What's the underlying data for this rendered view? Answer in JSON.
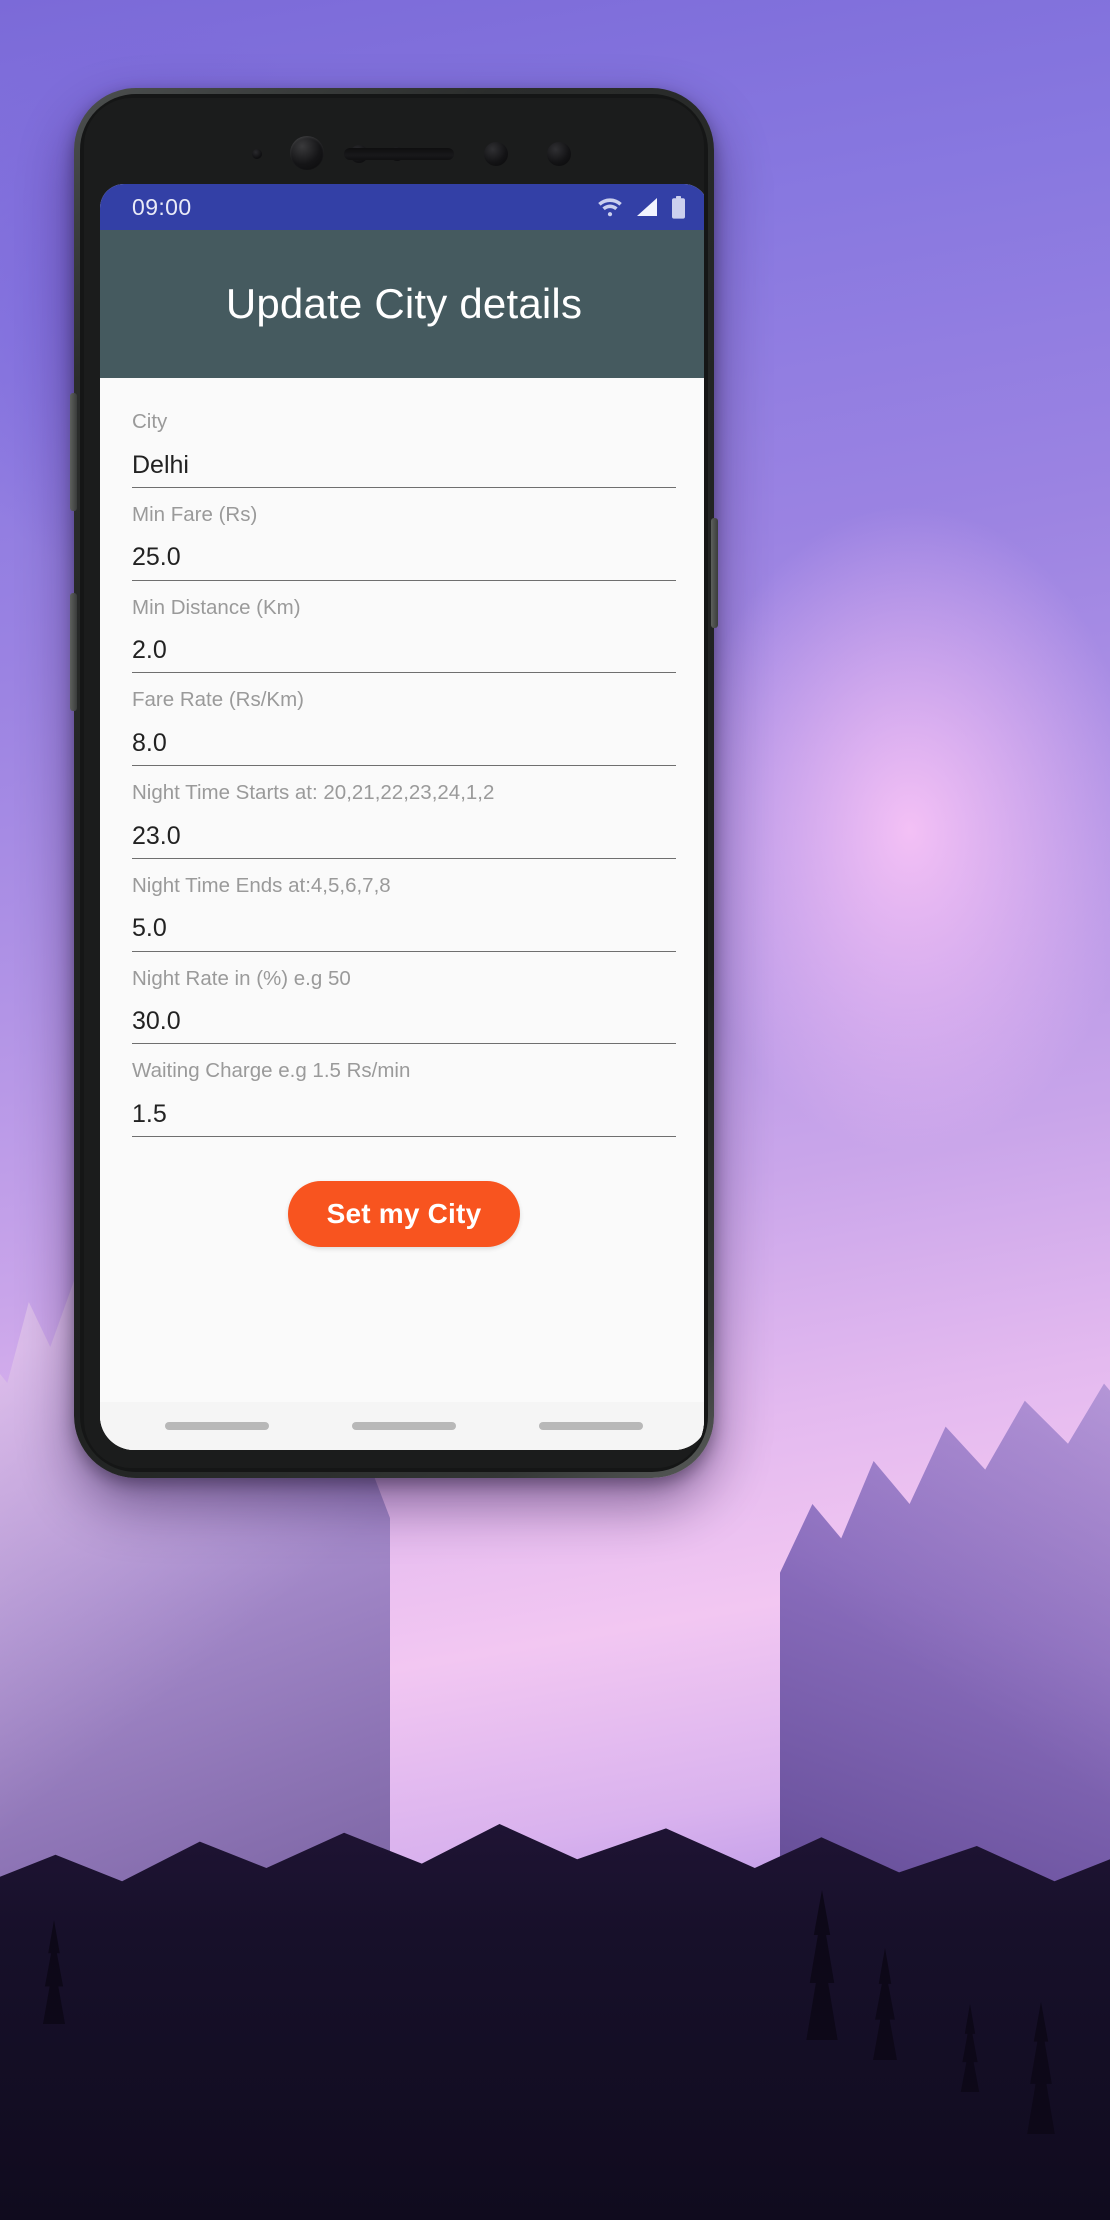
{
  "wallpaper": {
    "description": "purple-mountain-landscape",
    "colors": {
      "sky_top": "#7b6ad8",
      "sky_mid": "#c9a5ea",
      "sky_pink": "#f2c7f2",
      "mountain": "#a88dcd",
      "forest": "#17102a"
    }
  },
  "device": {
    "frame_color": "#232524",
    "sensors": [
      "front-camera",
      "proximity-sensor",
      "iris-scanner",
      "ambient-sensor",
      "earpiece-speaker"
    ],
    "side_buttons": [
      "volume-up",
      "volume-down",
      "power"
    ]
  },
  "status_bar": {
    "time": "09:00",
    "background": "#3340a6",
    "icons": [
      "wifi-icon",
      "cellular-signal-icon",
      "battery-icon"
    ]
  },
  "app_bar": {
    "title": "Update City details",
    "background": "#455a5f",
    "text_color": "#ffffff"
  },
  "form": {
    "fields": [
      {
        "label": "City",
        "value": "Delhi"
      },
      {
        "label": "Min Fare (Rs)",
        "value": "25.0"
      },
      {
        "label": "Min Distance (Km)",
        "value": "2.0"
      },
      {
        "label": "Fare Rate (Rs/Km)",
        "value": "8.0"
      },
      {
        "label": "Night Time Starts at: 20,21,22,23,24,1,2",
        "value": "23.0"
      },
      {
        "label": "Night Time Ends at:4,5,6,7,8",
        "value": "5.0"
      },
      {
        "label": "Night Rate in (%) e.g 50",
        "value": "30.0"
      },
      {
        "label": "Waiting Charge e.g 1.5 Rs/min",
        "value": "1.5"
      }
    ]
  },
  "submit_button": {
    "label": "Set my City",
    "background": "#f8541f",
    "text_color": "#ffffff"
  },
  "nav_bar": {
    "pills": [
      "recents-pill",
      "home-pill",
      "back-pill"
    ],
    "background": "#f5f5f5"
  }
}
